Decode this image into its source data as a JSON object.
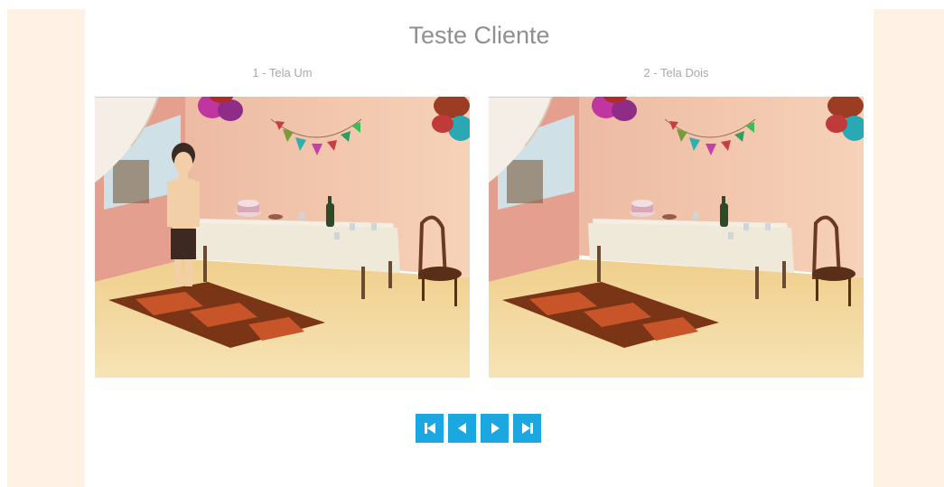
{
  "title": "Teste Cliente",
  "screens": [
    {
      "label": "1 - Tela Um",
      "has_character": true
    },
    {
      "label": "2 - Tela Dois",
      "has_character": false
    }
  ],
  "controls": [
    {
      "name": "first-button",
      "icon": "skip-to-start-icon"
    },
    {
      "name": "previous-button",
      "icon": "triangle-left-icon"
    },
    {
      "name": "next-button",
      "icon": "triangle-right-icon"
    },
    {
      "name": "last-button",
      "icon": "skip-to-end-icon"
    }
  ],
  "colors": {
    "side_panel": "#fff1e3",
    "button": "#1ba8e0",
    "title_text": "#8f8f8f",
    "label_text": "#a9a9a9"
  }
}
